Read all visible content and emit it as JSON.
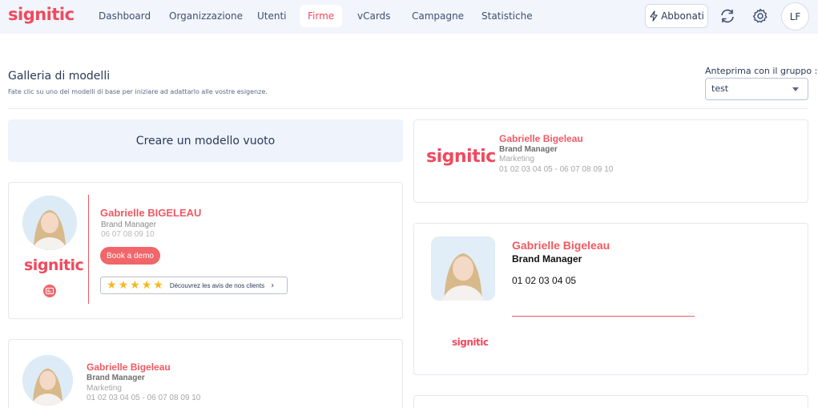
{
  "app": {
    "logo": "signitic"
  },
  "nav": {
    "items": [
      "Dashboard",
      "Organizzazione",
      "Utenti",
      "Firme",
      "vCards",
      "Campagne",
      "Statistiche"
    ],
    "active": "Firme"
  },
  "toolbar": {
    "subscribe_label": "Abbonati",
    "user_initials": "LF"
  },
  "header": {
    "title": "Galleria di modelli",
    "subtitle": "Fate clic su uno dei modelli di base per iniziare ad adattarlo alle vostre esigenze.",
    "group_label": "Anteprima con il gruppo :",
    "group_value": "test"
  },
  "templates": {
    "empty_label": "Creare un modello vuoto",
    "card1": {
      "name": "Gabrielle BIGELEAU",
      "role": "Brand Manager",
      "phone": "06 07 08 09 10",
      "logo": "signitic",
      "cta_label": "Book a demo",
      "reviews_label": "Découvrez les avis de nos clients",
      "stars": 5
    },
    "card2": {
      "logo": "signitic",
      "name": "Gabrielle Bigeleau",
      "role": "Brand Manager",
      "dept": "Marketing",
      "phones": "01 02 03 04 05 - 06 07 08 09 10"
    },
    "card3": {
      "name": "Gabrielle Bigeleau",
      "role": "Brand Manager",
      "phone": "01 02 03 04 05",
      "logo": "signitic"
    },
    "card4": {
      "name": "Gabrielle Bigeleau",
      "role": "Brand Manager",
      "dept": "Marketing",
      "phones": "01 02 03 04 05 - 06 07 08 09 10"
    }
  },
  "colors": {
    "brand": "#f0495e",
    "accent_name": "#ef5a63",
    "nav_bg": "#f2f5fb"
  }
}
